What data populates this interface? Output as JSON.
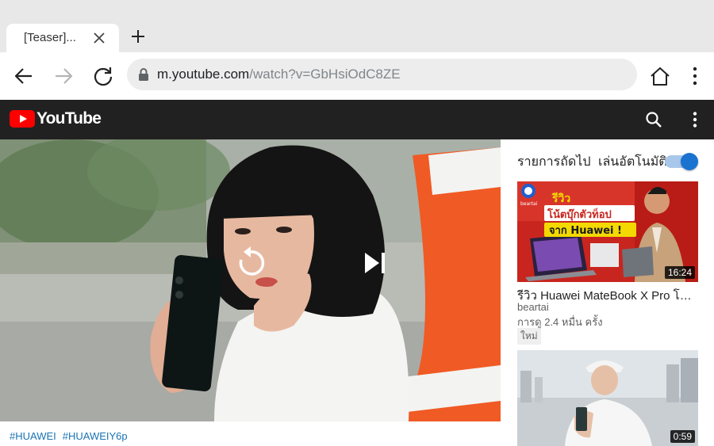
{
  "browser": {
    "tab_title": "[Teaser]...",
    "url_host": "m.youtube.com",
    "url_path": "/watch?v=GbHsiOdC8ZE"
  },
  "youtube": {
    "wordmark": "YouTube",
    "brand_color": "#ff0000"
  },
  "player": {
    "hashtags": [
      "#HUAWEI",
      "#HUAWEIY6p"
    ]
  },
  "sidebar": {
    "up_next_label": "รายการถัดไป",
    "autoplay_label": "เล่นอัตโนมัติ",
    "autoplay_on": true,
    "videos": [
      {
        "duration": "16:24",
        "thumb_text_1": "รีวิว",
        "thumb_text_2": "โน้ตบุ๊กตัวท็อป",
        "thumb_text_3": "จาก Huawei !",
        "thumb_logo": "beartai",
        "title": "รีวิว Huawei MateBook X Pro โน้ตบุ๊กตัวท็อปจาก Huawei",
        "channel": "beartai",
        "views": "การดู 2.4 หมื่น ครั้ง",
        "badge": "ใหม่"
      },
      {
        "duration": "0:59"
      }
    ]
  },
  "icons": {
    "back": "back-arrow-icon",
    "forward": "forward-arrow-icon",
    "reload": "reload-icon",
    "home": "home-icon",
    "menu": "more-vert-icon",
    "search": "search-icon",
    "replay": "replay-icon",
    "next": "skip-next-icon"
  }
}
